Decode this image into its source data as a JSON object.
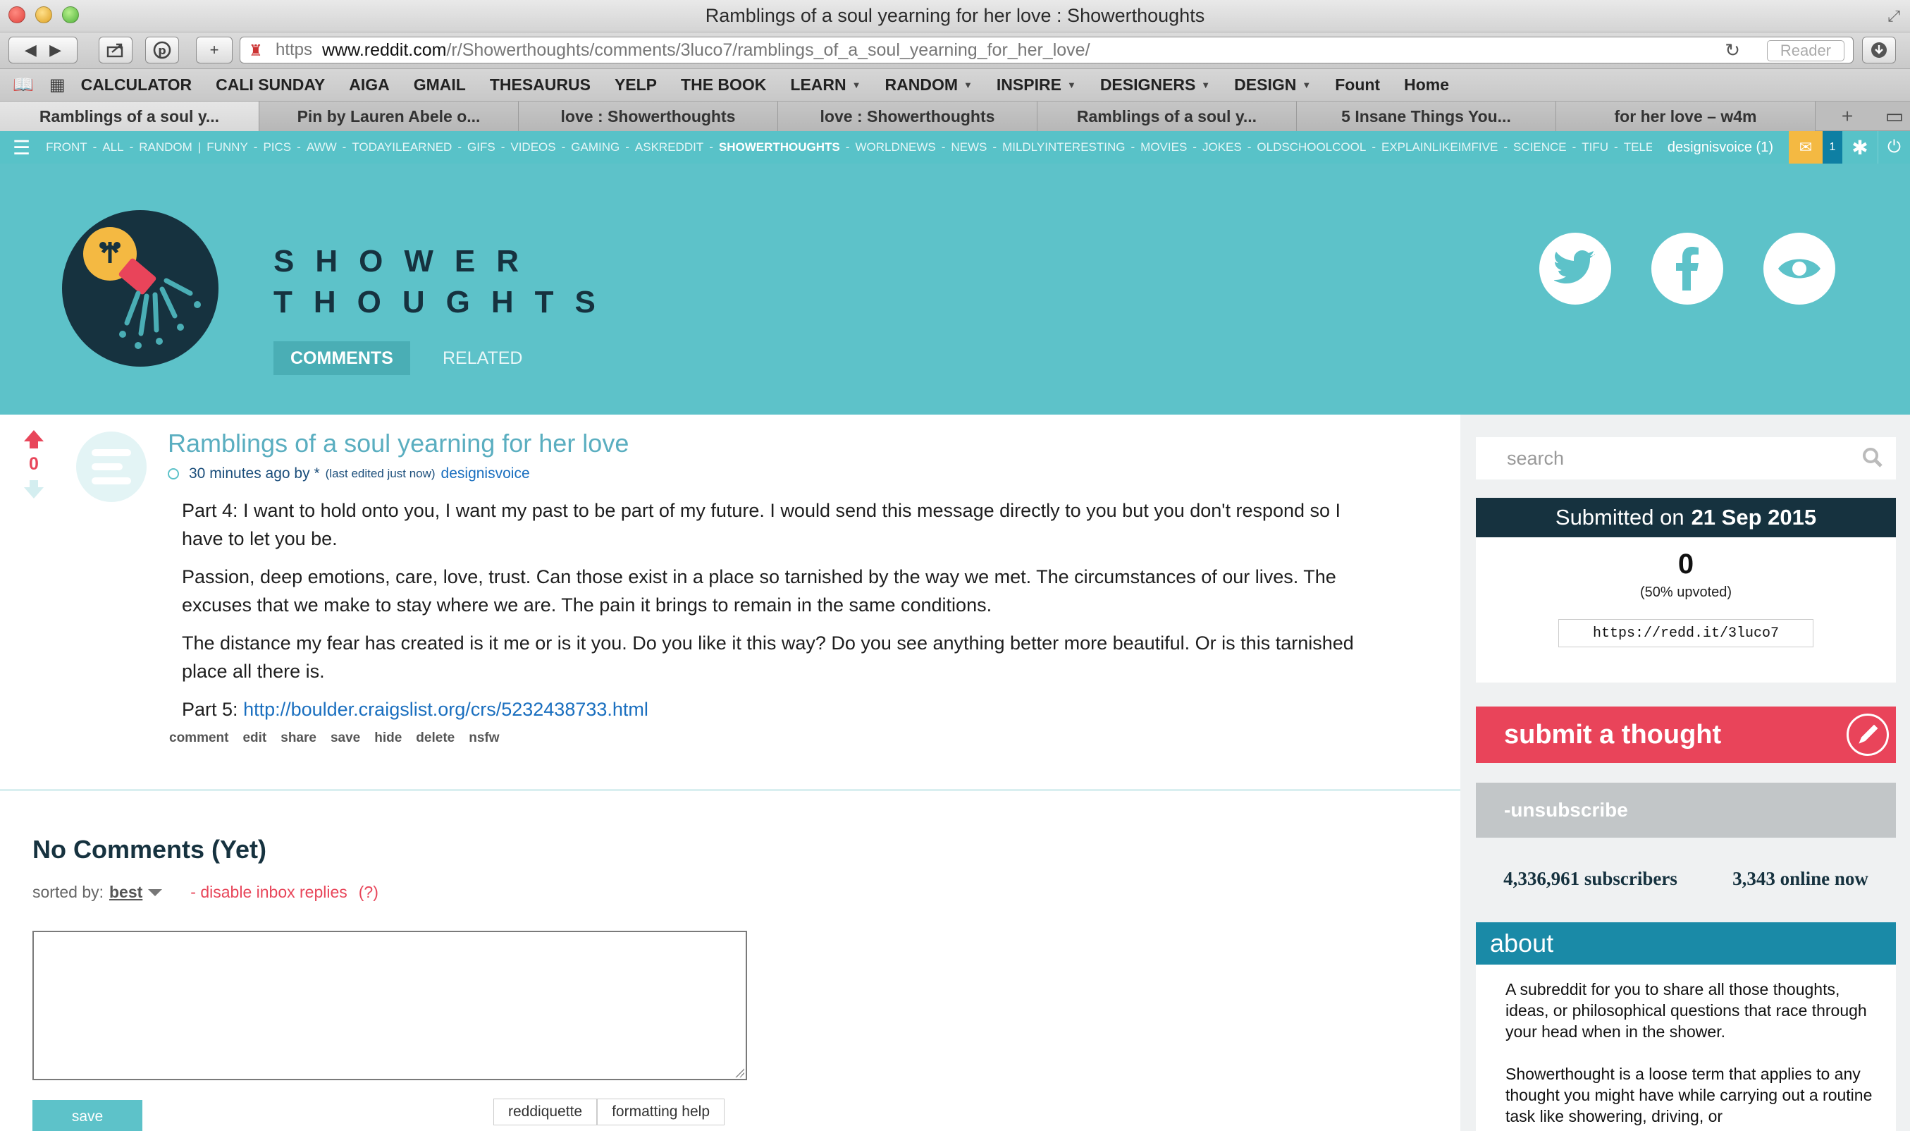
{
  "window": {
    "title": "Ramblings of a soul yearning for her love : Showerthoughts"
  },
  "address": {
    "scheme": "https",
    "host": "www.reddit.com",
    "path": "/r/Showerthoughts/comments/3luco7/ramblings_of_a_soul_yearning_for_her_love/",
    "reader_label": "Reader"
  },
  "bookmarks": [
    {
      "label": "CALCULATOR",
      "menu": false
    },
    {
      "label": "CALI SUNDAY",
      "menu": false
    },
    {
      "label": "AIGA",
      "menu": false
    },
    {
      "label": "GMAIL",
      "menu": false
    },
    {
      "label": "THESAURUS",
      "menu": false
    },
    {
      "label": "YELP",
      "menu": false
    },
    {
      "label": "THE BOOK",
      "menu": false
    },
    {
      "label": "LEARN",
      "menu": true
    },
    {
      "label": "RANDOM",
      "menu": true
    },
    {
      "label": "INSPIRE",
      "menu": true
    },
    {
      "label": "DESIGNERS",
      "menu": true
    },
    {
      "label": "DESIGN",
      "menu": true
    },
    {
      "label": "Fount",
      "menu": false
    },
    {
      "label": "Home",
      "menu": false
    }
  ],
  "tabs": [
    "Ramblings of a soul y...",
    "Pin by Lauren Abele o...",
    "love : Showerthoughts",
    "love : Showerthoughts",
    "Ramblings of a soul y...",
    "5 Insane Things You...",
    "for her love – w4m"
  ],
  "srbar": {
    "items": [
      "FRONT",
      "ALL",
      "RANDOM",
      "|",
      "FUNNY",
      "PICS",
      "AWW",
      "TODAYILEARNED",
      "GIFS",
      "VIDEOS",
      "GAMING",
      "ASKREDDIT",
      "SHOWERTHOUGHTS",
      "WORLDNEWS",
      "NEWS",
      "MILDLYINTERESTING",
      "MOVIES",
      "JOKES",
      "OLDSCHOOLCOOL",
      "EXPLAINLIKEIMFIVE",
      "SCIENCE",
      "TIFU",
      "TELEVIS"
    ],
    "current": "SHOWERTHOUGHTS",
    "user": "designisvoice (1)",
    "mail_count": "1"
  },
  "header": {
    "brand_line1": "SHOWER",
    "brand_line2": "THOUGHTS",
    "tab_comments": "COMMENTS",
    "tab_related": "RELATED"
  },
  "post": {
    "score": "0",
    "title": "Ramblings of a soul yearning for her love",
    "time": "30 minutes ago by",
    "star": "*",
    "edited": "(last edited just now)",
    "author": "designisvoice",
    "paragraphs": [
      "Part 4: I want to hold onto you, I want my past to be part of my future. I would send this message directly to you but you don't respond so I have to let you be.",
      "Passion, deep emotions, care, love, trust. Can those exist in a place so tarnished by the way we met. The circumstances of our lives. The excuses that we make to stay where we are. The pain it brings to remain in the same conditions.",
      "The distance my fear has created is it me or is it you. Do you like it this way? Do you see anything better more beautiful. Or is this tarnished place all there is."
    ],
    "part5_label": "Part 5:",
    "part5_link": "http://boulder.craigslist.org/crs/5232438733.html",
    "actions": [
      "comment",
      "edit",
      "share",
      "save",
      "hide",
      "delete",
      "nsfw"
    ]
  },
  "comments": {
    "heading": "No Comments (Yet)",
    "sorted_label": "sorted by:",
    "sorted_value": "best",
    "disable": "- disable inbox replies",
    "help_q": "(?)",
    "save_label": "save",
    "reddiquette": "reddiquette",
    "formatting": "formatting help"
  },
  "sidebar": {
    "search_placeholder": "search",
    "submitted_prefix": "Submitted on",
    "submitted_date": "21 Sep 2015",
    "score": "0",
    "upvoted": "(50% upvoted)",
    "shortlink": "https://redd.it/3luco7",
    "submit_label": "submit a thought",
    "unsubscribe_label": "-unsubscribe",
    "subscribers": "4,336,961 subscribers",
    "online": "3,343 online now",
    "about_heading": "about",
    "about_p1": "A subreddit for you to share all those thoughts, ideas, or philosophical questions that race through your head when in the shower.",
    "about_p2": "Showerthought is a loose term that applies to any thought you might have while carrying out a routine task like showering, driving, or"
  },
  "colors": {
    "teal": "#5dc2c9",
    "navy": "#16323f",
    "red": "#e9445a",
    "blue": "#1a8aa7"
  }
}
